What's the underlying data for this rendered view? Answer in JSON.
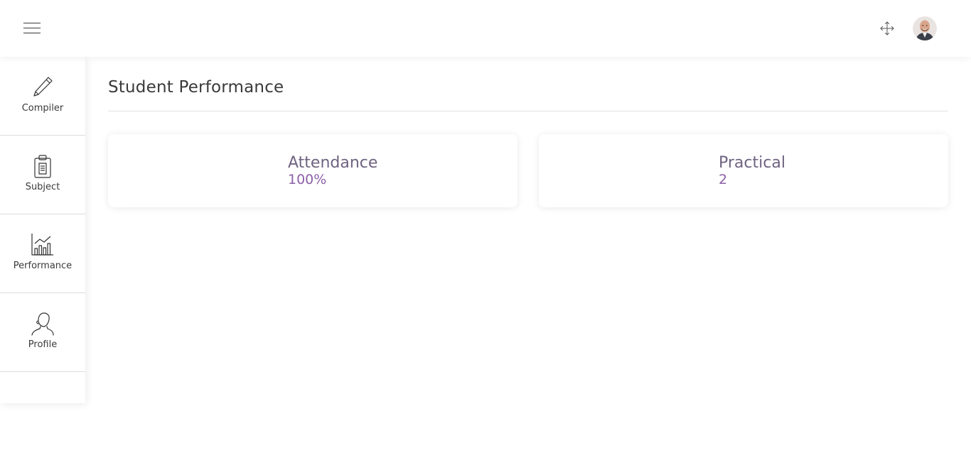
{
  "header": {
    "menu_icon": "hamburger-menu-icon",
    "fullscreen_icon": "fullscreen-arrows-icon",
    "avatar_icon": "user-avatar"
  },
  "sidebar": {
    "items": [
      {
        "label": "Compiler",
        "icon": "pencil-icon"
      },
      {
        "label": "Subject",
        "icon": "clipboard-icon"
      },
      {
        "label": "Performance",
        "icon": "bar-chart-icon"
      },
      {
        "label": "Profile",
        "icon": "user-icon"
      }
    ]
  },
  "main": {
    "title": "Student Performance",
    "cards": [
      {
        "title": "Attendance",
        "value": "100%"
      },
      {
        "title": "Practical",
        "value": "2"
      }
    ]
  },
  "colors": {
    "accent": "#8c5fa8",
    "card_title": "#6e6380",
    "text": "#3a3a3a"
  }
}
